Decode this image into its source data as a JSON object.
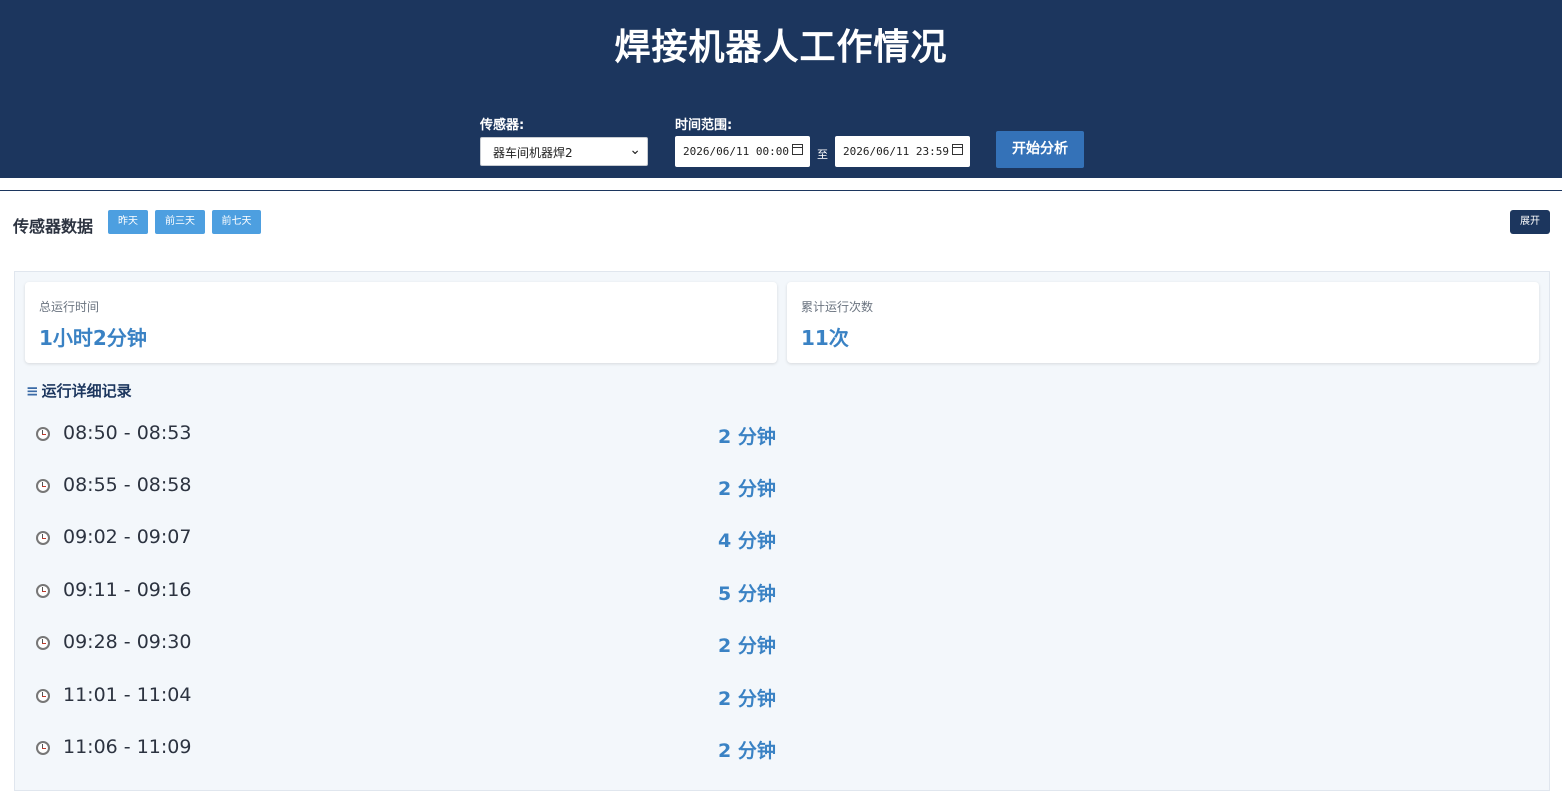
{
  "header": {
    "title": "焊接机器人工作情况",
    "sensor_label": "传感器:",
    "sensor_value": "器车间机器焊2",
    "time_range_label": "时间范围:",
    "start_datetime": "2026/06/11 00:00",
    "end_datetime": "2026/06/11 23:59",
    "to_label": "至",
    "analyze_label": "开始分析"
  },
  "section": {
    "title": "传感器数据",
    "quick_buttons": [
      "昨天",
      "前三天",
      "前七天"
    ],
    "expand_label": "展开"
  },
  "summary": {
    "total_time_label": "总运行时间",
    "total_time_value": "1小时2分钟",
    "count_label": "累计运行次数",
    "count_value": "11次"
  },
  "log": {
    "title": "运行详细记录",
    "icon": "list-icon",
    "rows": [
      {
        "time": "08:50 - 08:53",
        "duration": "2 分钟"
      },
      {
        "time": "08:55 - 08:58",
        "duration": "2 分钟"
      },
      {
        "time": "09:02 - 09:07",
        "duration": "4 分钟"
      },
      {
        "time": "09:11 - 09:16",
        "duration": "5 分钟"
      },
      {
        "time": "09:28 - 09:30",
        "duration": "2 分钟"
      },
      {
        "time": "11:01 - 11:04",
        "duration": "2 分钟"
      },
      {
        "time": "11:06 - 11:09",
        "duration": "2 分钟"
      }
    ]
  },
  "colors": {
    "header_bg": "#1c365e",
    "accent": "#3a82c4",
    "quick_button": "#4d9fe0",
    "analyze_button": "#3472b8"
  }
}
